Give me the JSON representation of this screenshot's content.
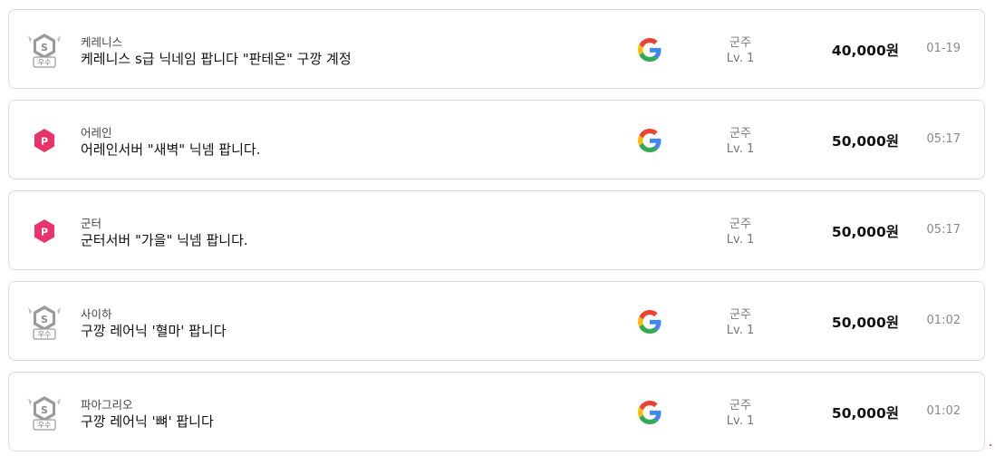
{
  "listings": [
    {
      "badge": "excellent-seller-badge",
      "badge_text": "우수",
      "server": "케레니스",
      "title": "케레니스 s급 닉네임 팝니다 \"판테온\" 구깡 계정",
      "google_linked": true,
      "category": "군주",
      "level": "Lv. 1",
      "price": "40,000원",
      "time": "01-19"
    },
    {
      "badge": "power-seller-badge",
      "server": "어레인",
      "title": "어레인서버 \"새벽\" 닉넴 팝니다.",
      "google_linked": true,
      "category": "군주",
      "level": "Lv. 1",
      "price": "50,000원",
      "time": "05:17"
    },
    {
      "badge": "power-seller-badge",
      "server": "군터",
      "title": "군터서버 \"가을\" 닉넴 팝니다.",
      "google_linked": false,
      "category": "군주",
      "level": "Lv. 1",
      "price": "50,000원",
      "time": "05:17"
    },
    {
      "badge": "excellent-seller-badge",
      "badge_text": "우수",
      "server": "사이하",
      "title": "구깡 레어닉 '혈마' 팝니다",
      "google_linked": true,
      "category": "군주",
      "level": "Lv. 1",
      "price": "50,000원",
      "time": "01:02"
    },
    {
      "badge": "excellent-seller-badge",
      "badge_text": "우수",
      "server": "파아그리오",
      "title": "구깡 레어닉 '뼈' 팝니다",
      "google_linked": true,
      "category": "군주",
      "level": "Lv. 1",
      "price": "50,000원",
      "time": "01:02"
    }
  ],
  "colors": {
    "power_badge": "#e8336b",
    "excellent_badge": "#9a9a9a",
    "google_blue": "#4285F4",
    "google_red": "#EA4335",
    "google_yellow": "#FBBC05",
    "google_green": "#34A853"
  }
}
